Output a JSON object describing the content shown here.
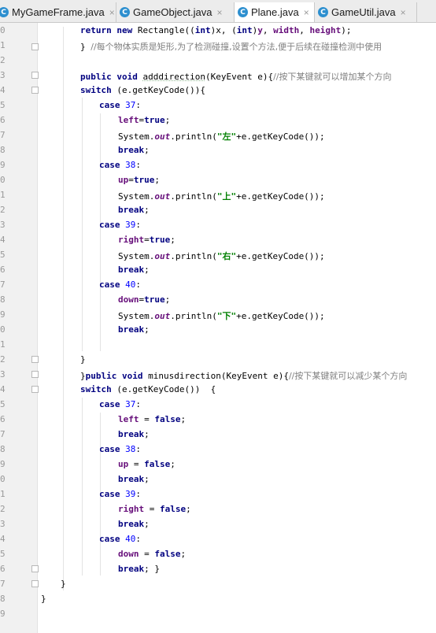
{
  "tabs": [
    {
      "label": "MyGameFrame.java",
      "active": false
    },
    {
      "label": "GameObject.java",
      "active": false
    },
    {
      "label": "Plane.java",
      "active": true
    },
    {
      "label": "GameUtil.java",
      "active": false
    }
  ],
  "tab_icon_letter": "C",
  "tab_close_glyph": "×",
  "line_numbers": [
    "0",
    "1",
    "2",
    "3",
    "4",
    "5",
    "6",
    "7",
    "8",
    "9",
    "0",
    "1",
    "2",
    "3",
    "4",
    "5",
    "6",
    "7",
    "8",
    "9",
    "0",
    "1",
    "2",
    "3",
    "4",
    "5",
    "6",
    "7",
    "8",
    "9",
    "0",
    "1",
    "2",
    "3",
    "4",
    "5",
    "6",
    "7",
    "8",
    "9"
  ],
  "code": {
    "l0": {
      "kw1": "return",
      "kw2": "new",
      "t1": " Rectangle((",
      "kw3": "int",
      "t2": ")x, (",
      "kw4": "int",
      "t3": ")",
      "f1": "y",
      "t4": ", ",
      "f2": "width",
      "t5": ", ",
      "f3": "height",
      "t6": ");"
    },
    "l1": {
      "t": "} ",
      "c": "//每个物体实质是矩形,为了检测碰撞,设置个方法,便于后续在碰撞检测中使用"
    },
    "l3": {
      "kw1": "public",
      "kw2": "void",
      "name": "adddirection",
      "t": "(KeyEvent e){",
      "c": "//按下某键就可以增加某个方向"
    },
    "l4": {
      "kw": "switch",
      "t": " (e.getKeyCode()){"
    },
    "cases_add": [
      {
        "num": "37",
        "field": "left",
        "str": "\"左\""
      },
      {
        "num": "38",
        "field": "up",
        "str": "\"上\""
      },
      {
        "num": "39",
        "field": "right",
        "str": "\"右\""
      },
      {
        "num": "40",
        "field": "down",
        "str": "\"下\""
      }
    ],
    "kw_case": "case",
    "kw_break": "break",
    "kw_true": "true",
    "kw_false": "false",
    "sys_a": "System.",
    "sys_out": "out",
    "sys_b": ".println(",
    "sys_c": "+e.getKeyCode());",
    "l22": {
      "t": "}"
    },
    "l23": {
      "t": "}",
      "kw1": "public",
      "kw2": "void",
      "name": "minusdirection",
      "t2": "(KeyEvent e){",
      "c": "//按下某键就可以减少某个方向"
    },
    "l24": {
      "kw": "switch",
      "t": " (e.getKeyCode())  {"
    },
    "cases_minus": [
      {
        "num": "37",
        "field": "left"
      },
      {
        "num": "38",
        "field": "up"
      },
      {
        "num": "39",
        "field": "right"
      },
      {
        "num": "40",
        "field": "down"
      }
    ],
    "l37": {
      "t": "}"
    },
    "l38": {
      "t": "}"
    },
    "last_break_tail": " }"
  }
}
